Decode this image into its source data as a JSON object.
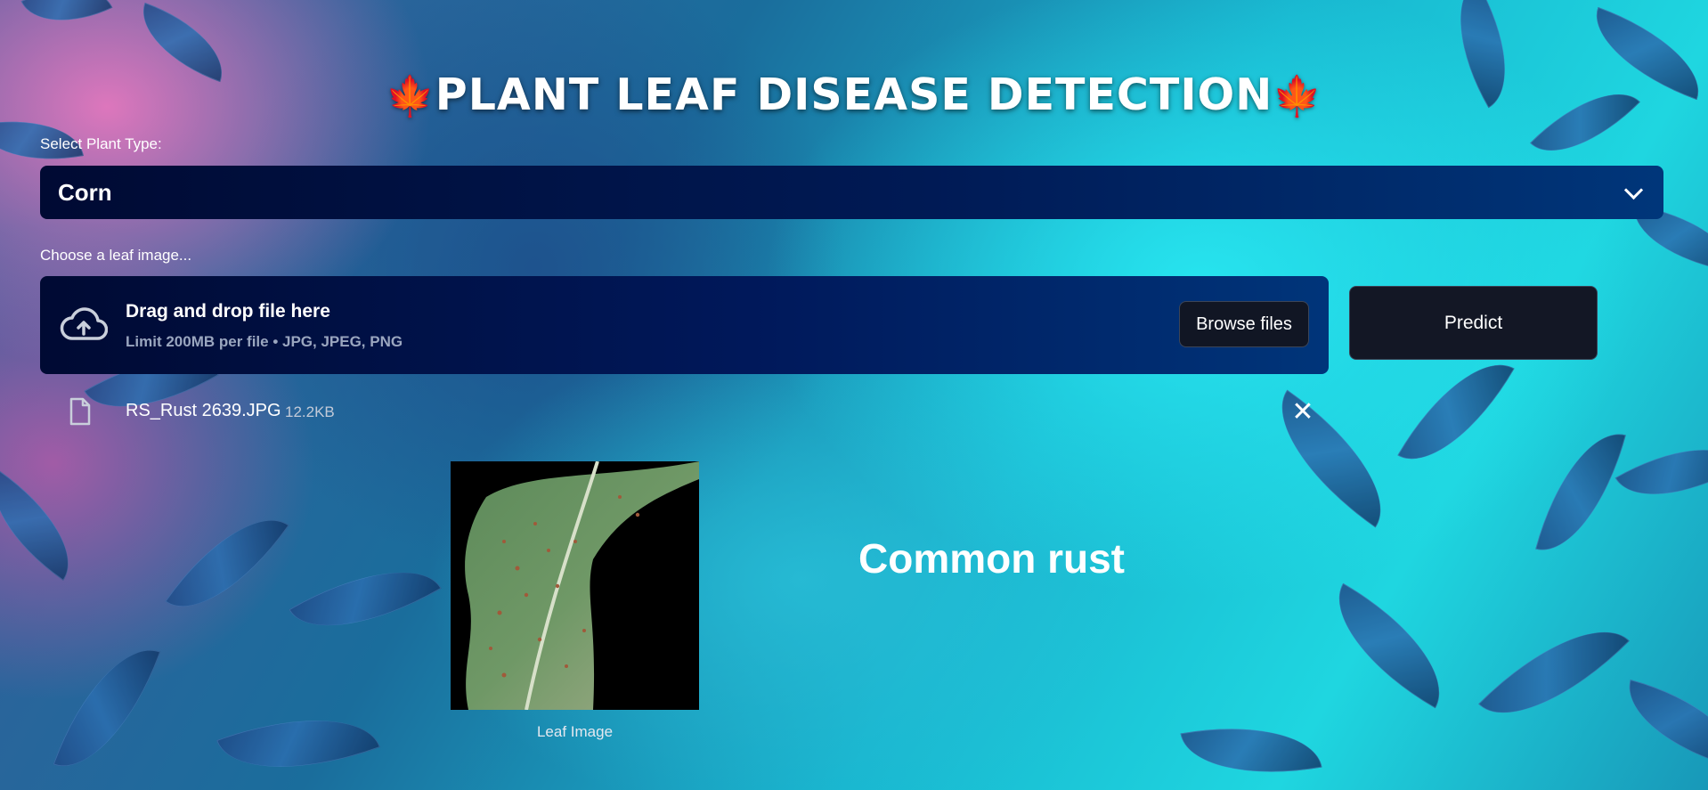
{
  "header": {
    "title": "PLANT LEAF DISEASE DETECTION",
    "emoji_left": "🍁",
    "emoji_right": "🍁"
  },
  "plant_select": {
    "label": "Select Plant Type:",
    "selected": "Corn",
    "icon": "chevron-down-icon"
  },
  "uploader": {
    "label": "Choose a leaf image...",
    "drop_title": "Drag and drop file here",
    "drop_subtitle": "Limit 200MB per file • JPG, JPEG, PNG",
    "browse_label": "Browse files",
    "icon": "cloud-upload-icon"
  },
  "predict_button": {
    "label": "Predict"
  },
  "uploaded_file": {
    "name": "RS_Rust 2639.JPG",
    "size": "12.2KB",
    "icon": "file-icon",
    "remove_icon": "close-icon",
    "remove_glyph": "✕"
  },
  "result": {
    "image_caption": "Leaf Image",
    "prediction": "Common rust"
  },
  "colors": {
    "accent_dark": "#000a33",
    "accent_blue": "#00367a",
    "button_bg": "#131725",
    "maple_red": "#e03636"
  }
}
